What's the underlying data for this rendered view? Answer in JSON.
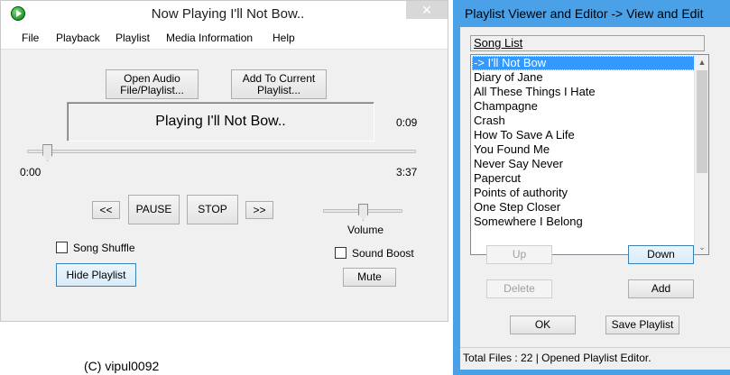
{
  "main_window": {
    "title": "Now Playing I'll Not Bow..",
    "close_glyph": "✕",
    "menu": [
      "File",
      "Playback",
      "Playlist",
      "Media Information",
      "Help"
    ],
    "open_button": "Open Audio File/Playlist...",
    "add_button": "Add To Current Playlist...",
    "now_playing": "Playing I'll Not Bow..",
    "elapsed_time": "0:09",
    "start_time": "0:00",
    "total_time": "3:37",
    "seek_progress": 0.04,
    "volume_label": "Volume",
    "volume_level": 0.5,
    "prev_button": "<<",
    "pause_button": "PAUSE",
    "stop_button": "STOP",
    "next_button": ">>",
    "song_shuffle_label": "Song Shuffle",
    "sound_boost_label": "Sound Boost",
    "hide_playlist_button": "Hide Playlist",
    "mute_button": "Mute"
  },
  "playlist_window": {
    "title": "Playlist Viewer and Editor -> View and Edit",
    "header": "Song List",
    "songs": [
      "-> I'll Not Bow",
      "Diary of Jane",
      "All These Things I Hate",
      "Champagne",
      "Crash",
      "How To Save A Life",
      "You Found Me",
      "Never Say Never",
      "Papercut",
      "Points of authority",
      "One Step Closer",
      "Somewhere I Belong"
    ],
    "scroll_up_glyph": "▲",
    "scroll_down_glyph": "⌄",
    "up_button": "Up",
    "down_button": "Down",
    "delete_button": "Delete",
    "add_button": "Add",
    "ok_button": "OK",
    "save_button": "Save Playlist",
    "status": "Total Files : 22  | Opened Playlist Editor."
  },
  "copyright": "(C) vipul0092"
}
